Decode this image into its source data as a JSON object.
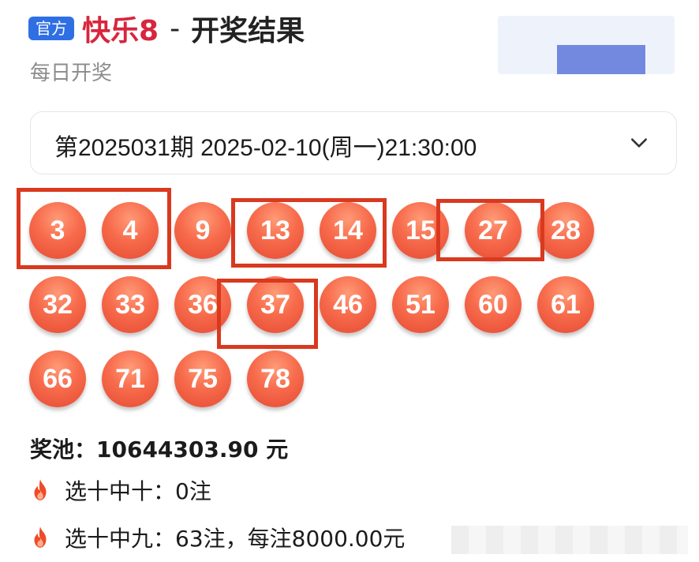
{
  "header": {
    "badge": "官方",
    "game_name": "快乐8",
    "separator": "-",
    "title_rest": "开奖结果",
    "subtitle": "每日开奖"
  },
  "period": {
    "label": "第2025031期 2025-02-10(周一)21:30:00",
    "icon": "chevron-down-icon"
  },
  "balls": [
    "3",
    "4",
    "9",
    "13",
    "14",
    "15",
    "27",
    "28",
    "32",
    "33",
    "36",
    "37",
    "46",
    "51",
    "60",
    "61",
    "66",
    "71",
    "75",
    "78"
  ],
  "pool": {
    "text": "奖池：10644303.90 元"
  },
  "prizes": [
    {
      "icon": "fire-icon",
      "text": "选十中十：0注"
    },
    {
      "icon": "fire-icon",
      "text": "选十中九：63注，每注8000.00元"
    }
  ],
  "colors": {
    "accent_red": "#d7263d",
    "badge_blue": "#2f6fe4",
    "ball": "#f76b4c",
    "highlight_box": "#d9391f"
  }
}
